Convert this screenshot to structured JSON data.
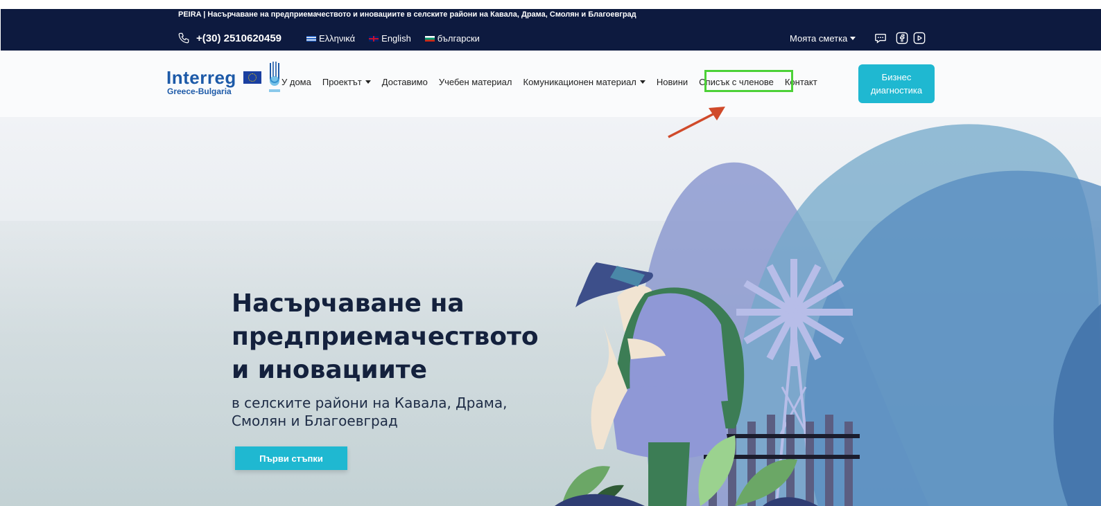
{
  "topbar": {
    "tagline": "PEIRA | Насърчаване на предприемачеството и иновациите в селските райони на Кавала, Драма, Смолян и Благоевград",
    "phone": "+(30) 2510620459",
    "languages": [
      {
        "label": "Ελληνικά",
        "flag": "greek-flag-icon"
      },
      {
        "label": "English",
        "flag": "uk-flag-icon"
      },
      {
        "label": "български",
        "flag": "bulgarian-flag-icon"
      }
    ],
    "account": "Моята сметка",
    "social_icons": [
      "chat-icon",
      "facebook-icon",
      "youtube-icon"
    ]
  },
  "logo": {
    "interreg": "Interreg",
    "region": "Greece-Bulgaria"
  },
  "nav": {
    "items": [
      {
        "label": "У дома",
        "dropdown": false
      },
      {
        "label": "Проектът",
        "dropdown": true
      },
      {
        "label": "Доставимо",
        "dropdown": false
      },
      {
        "label": "Учебен материал",
        "dropdown": false
      },
      {
        "label": "Комуникационен материал",
        "dropdown": true
      },
      {
        "label": "Новини",
        "dropdown": false
      },
      {
        "label": "Списък с членове",
        "dropdown": false
      },
      {
        "label": "Контакт",
        "dropdown": false
      }
    ],
    "cta": "Бизнес\nдиагностика"
  },
  "hero": {
    "title": "Насърчаване на предприемачеството и иновациите",
    "subtitle": "в селските райони на Кавала, Драма, Смолян и Благоевград",
    "button": "Първи стъпки"
  },
  "colors": {
    "topbar_bg": "#0d1a3f",
    "accent": "#1fb8d1",
    "highlight": "#4cd137",
    "arrow": "#d04a2a",
    "title": "#14213d"
  }
}
